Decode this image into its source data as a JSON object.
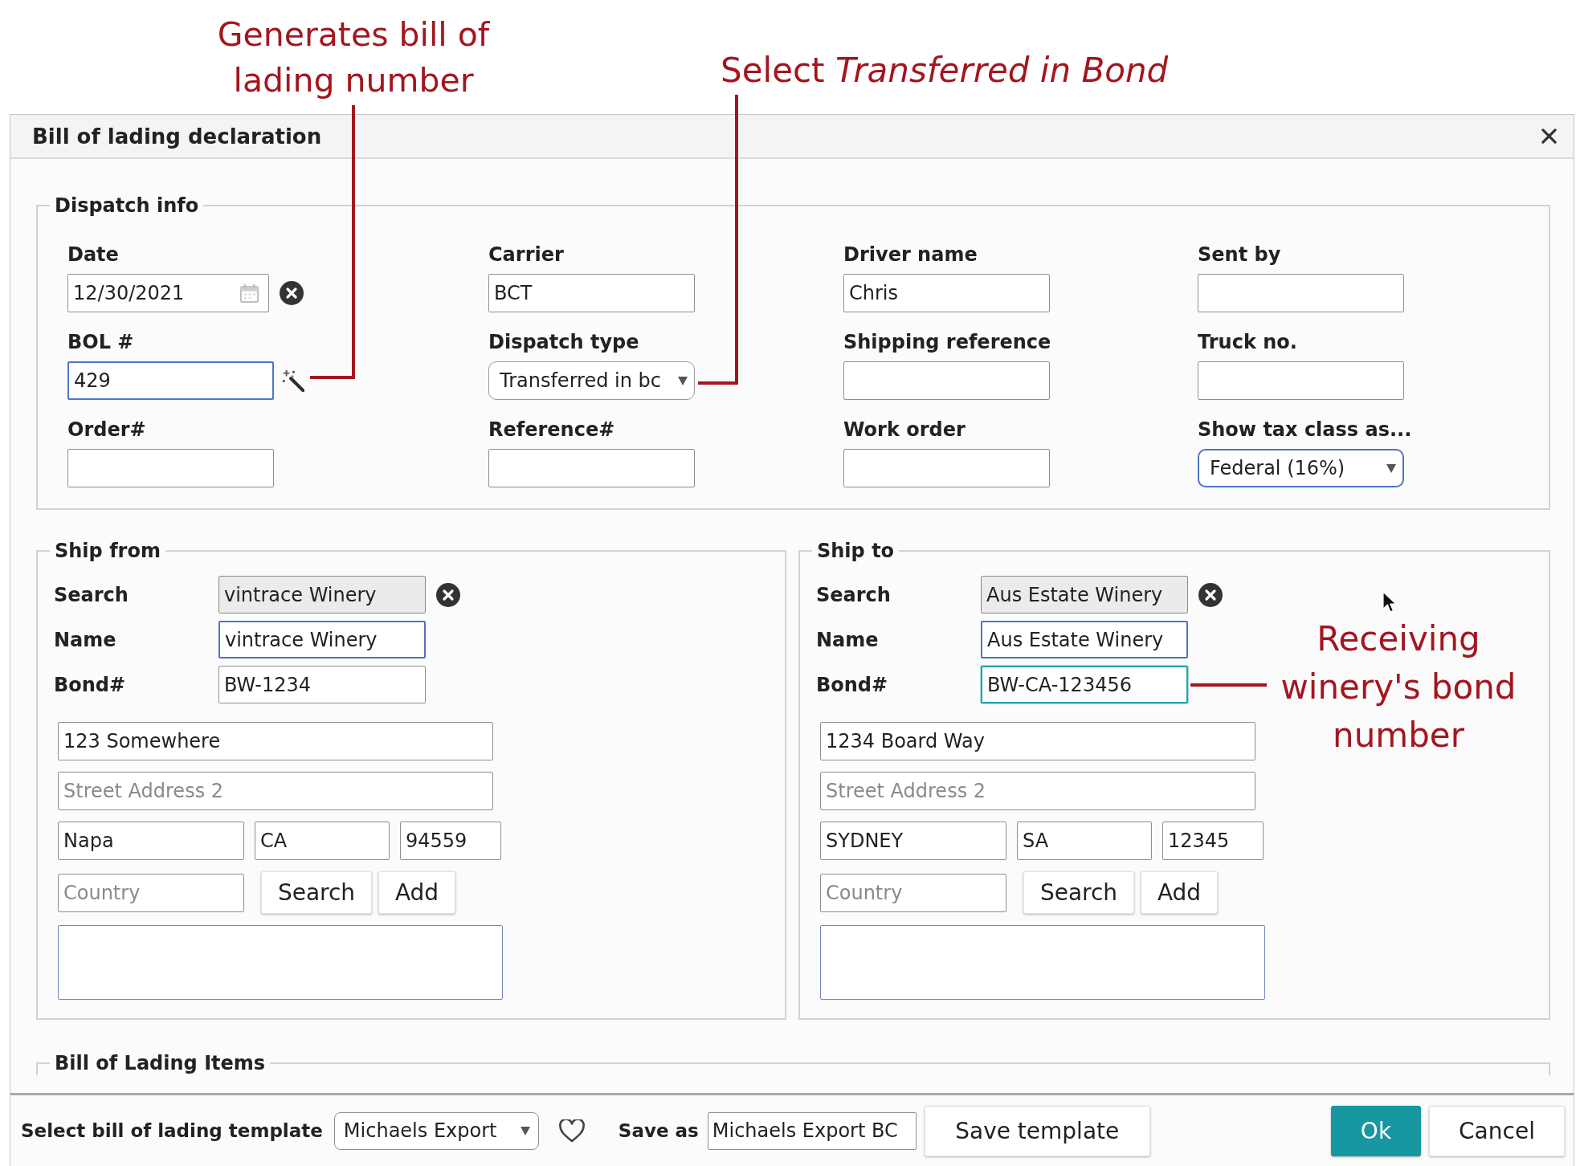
{
  "annotations": [
    {
      "text": "Generates bill of lading number"
    },
    {
      "text": "Select *Transferred in Bond*"
    },
    {
      "text": "Receiving winery's bond number"
    }
  ],
  "dialog": {
    "title": "Bill of lading declaration"
  },
  "dispatch_info": {
    "title": "Dispatch info",
    "fields": [
      {
        "label": "Date",
        "kind": "date",
        "value": "12/30/2021",
        "highlighted": false
      },
      {
        "label": "Carrier",
        "kind": "text",
        "value": "BCT",
        "highlighted": false
      },
      {
        "label": "Driver name",
        "kind": "text",
        "value": "Chris",
        "highlighted": false
      },
      {
        "label": "Sent by",
        "kind": "text",
        "highlighted": false
      },
      {
        "label": "BOL #",
        "kind": "generate",
        "value": "429",
        "highlighted": true
      },
      {
        "label": "Dispatch type",
        "kind": "select",
        "value": "Transferred in bc",
        "highlighted": false
      },
      {
        "label": "Shipping reference",
        "kind": "text",
        "highlighted": false
      },
      {
        "label": "Truck no.",
        "kind": "text",
        "highlighted": false
      },
      {
        "label": "Order#",
        "kind": "text",
        "highlighted": false
      },
      {
        "label": "Reference#",
        "kind": "text",
        "highlighted": false
      },
      {
        "label": "Work order",
        "kind": "text",
        "highlighted": false
      },
      {
        "label": "Show tax class as...",
        "kind": "select",
        "value": "Federal (16%)",
        "highlighted": true
      }
    ]
  },
  "ship_from": {
    "title": "Ship from",
    "rows": [
      {
        "label": "Search",
        "value": "vintrace Winery",
        "read_only": true,
        "highlighted": false,
        "focused": false,
        "clearable": true
      },
      {
        "label": "Name",
        "value": "vintrace Winery",
        "read_only": false,
        "highlighted": true,
        "focused": false,
        "clearable": false
      },
      {
        "label": "Bond#",
        "value": "BW-1234",
        "read_only": false,
        "highlighted": false,
        "focused": false,
        "clearable": false
      }
    ],
    "address": [
      {
        "value": "123 Somewhere"
      },
      {
        "placeholder": "Street Address 2"
      }
    ],
    "locality": [
      {
        "value": "Napa"
      },
      {
        "value": "CA"
      },
      {
        "value": "94559"
      }
    ],
    "country": {
      "placeholder": "Country"
    },
    "buttons": [
      {
        "label": "Search"
      },
      {
        "label": "Add"
      }
    ]
  },
  "ship_to": {
    "title": "Ship to",
    "rows": [
      {
        "label": "Search",
        "value": "Aus Estate Winery",
        "read_only": true,
        "highlighted": false,
        "focused": false,
        "clearable": true
      },
      {
        "label": "Name",
        "value": "Aus Estate Winery",
        "read_only": false,
        "highlighted": true,
        "focused": false,
        "clearable": false
      },
      {
        "label": "Bond#",
        "value": "BW-CA-123456",
        "read_only": false,
        "highlighted": false,
        "focused": true,
        "clearable": false
      }
    ],
    "address": [
      {
        "value": "1234 Board Way"
      },
      {
        "placeholder": "Street Address 2"
      }
    ],
    "locality": [
      {
        "value": "SYDNEY"
      },
      {
        "value": "SA"
      },
      {
        "value": "12345"
      }
    ],
    "country": {
      "placeholder": "Country"
    },
    "buttons": [
      {
        "label": "Search"
      },
      {
        "label": "Add"
      }
    ]
  },
  "items_section": {
    "title": "Bill of Lading Items"
  },
  "footer": {
    "template_label": "Select bill of lading template",
    "template_select": {
      "value": "Michaels Export"
    },
    "save_as_label": "Save as",
    "save_as": {
      "value": "Michaels Export BC"
    },
    "save_button": {
      "label": "Save template"
    },
    "buttons": [
      {
        "label": "Ok",
        "kind": "primary"
      },
      {
        "label": "Cancel",
        "kind": "secondary"
      }
    ]
  }
}
